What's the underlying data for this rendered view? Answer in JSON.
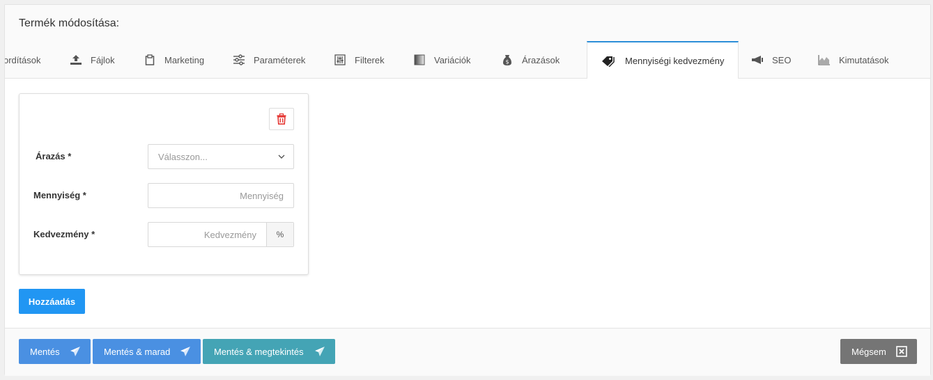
{
  "title": "Termék módosítása:",
  "tabs": [
    {
      "label": "ordítások",
      "icon": "translate-icon"
    },
    {
      "label": "Fájlok",
      "icon": "upload-icon"
    },
    {
      "label": "Marketing",
      "icon": "clipboard-icon"
    },
    {
      "label": "Paraméterek",
      "icon": "sliders-icon"
    },
    {
      "label": "Filterek",
      "icon": "filter-sliders-icon"
    },
    {
      "label": "Variációk",
      "icon": "gradient-icon"
    },
    {
      "label": "Árazások",
      "icon": "money-bag-icon"
    },
    {
      "label": "Mennyiségi kedvezmény",
      "icon": "tag-icon",
      "active": true
    },
    {
      "label": "SEO",
      "icon": "megaphone-icon"
    },
    {
      "label": "Kimutatások",
      "icon": "area-chart-icon"
    }
  ],
  "form": {
    "pricing_label": "Árazás *",
    "pricing_placeholder": "Válasszon...",
    "quantity_label": "Mennyiség *",
    "quantity_placeholder": "Mennyiség",
    "discount_label": "Kedvezmény *",
    "discount_placeholder": "Kedvezmény",
    "discount_unit": "%"
  },
  "add_button": "Hozzáadás",
  "footer": {
    "save": "Mentés",
    "save_stay": "Mentés & marad",
    "save_view": "Mentés & megtekintés",
    "cancel": "Mégsem"
  },
  "colors": {
    "primary_blue": "#2196f3",
    "save_blue": "#4a90e2",
    "teal": "#44a4b5",
    "cancel_gray": "#757575",
    "danger_red": "#e53935",
    "tab_active_border": "#2c8ed8"
  }
}
